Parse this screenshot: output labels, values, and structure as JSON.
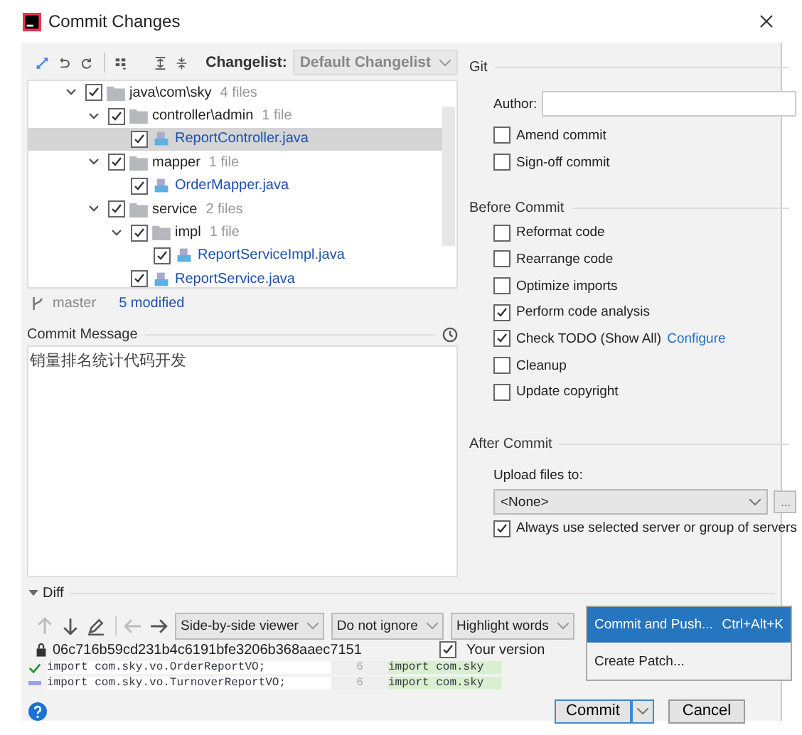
{
  "window": {
    "title": "Commit Changes"
  },
  "toolbar": {
    "changelist_label": "Changelist:",
    "changelist_value": "Default Changelist"
  },
  "tree": [
    {
      "name": "java\\com\\sky",
      "count": "4 files",
      "kind": "folder",
      "checked": true,
      "expanded": true,
      "selected": false,
      "children": [
        {
          "name": "controller\\admin",
          "count": "1 file",
          "kind": "folder",
          "checked": true,
          "expanded": true,
          "selected": false,
          "children": [
            {
              "name": "ReportController.java",
              "kind": "file",
              "checked": true,
              "selected": true
            }
          ]
        },
        {
          "name": "mapper",
          "count": "1 file",
          "kind": "folder",
          "checked": true,
          "expanded": true,
          "selected": false,
          "children": [
            {
              "name": "OrderMapper.java",
              "kind": "file",
              "checked": true,
              "selected": false
            }
          ]
        },
        {
          "name": "service",
          "count": "2 files",
          "kind": "folder",
          "checked": true,
          "expanded": true,
          "selected": false,
          "children": [
            {
              "name": "impl",
              "count": "1 file",
              "kind": "folder",
              "checked": true,
              "expanded": true,
              "selected": false,
              "children": [
                {
                  "name": "ReportServiceImpl.java",
                  "kind": "file",
                  "checked": true,
                  "selected": false
                }
              ]
            },
            {
              "name": "ReportService.java",
              "kind": "file",
              "checked": true,
              "selected": false
            }
          ]
        }
      ]
    }
  ],
  "status": {
    "branch": "master",
    "modified": "5 modified"
  },
  "commit_message": {
    "label": "Commit Message",
    "value": "销量排名统计代码开发"
  },
  "git": {
    "title": "Git",
    "author_label": "Author:",
    "options": [
      {
        "label": "Amend commit",
        "checked": false
      },
      {
        "label": "Sign-off commit",
        "checked": false
      }
    ]
  },
  "before_commit": {
    "title": "Before Commit",
    "options": [
      {
        "label": "Reformat code",
        "checked": false
      },
      {
        "label": "Rearrange code",
        "checked": false
      },
      {
        "label": "Optimize imports",
        "checked": false
      },
      {
        "label": "Perform code analysis",
        "checked": true
      },
      {
        "label": "Check TODO (Show All)",
        "checked": true,
        "link": "Configure"
      },
      {
        "label": "Cleanup",
        "checked": false
      },
      {
        "label": "Update copyright",
        "checked": false
      }
    ]
  },
  "after_commit": {
    "title": "After Commit",
    "upload_label": "Upload files to:",
    "upload_value": "<None>",
    "more": "...",
    "always": {
      "label": "Always use selected server or group of servers",
      "checked": true
    }
  },
  "diff": {
    "label": "Diff",
    "expanded": true,
    "viewer": "Side-by-side viewer",
    "ignore": "Do not ignore",
    "highlight": "Highlight words",
    "hash": "06c716b59cd231b4c6191bfe3206b368aaec7151",
    "your_version": {
      "label": "Your version",
      "checked": true
    },
    "lines": [
      {
        "number": "6",
        "left": "import com.sky.vo.OrderReportVO;",
        "right": "import com.sky"
      },
      {
        "number": "6",
        "left": "import com.sky.vo.TurnoverReportVO;",
        "right": "import com.sky"
      }
    ]
  },
  "menu": [
    {
      "label": "Commit and Push...",
      "shortcut": "Ctrl+Alt+K",
      "selected": true
    },
    {
      "label": "Create Patch...",
      "selected": false
    }
  ],
  "buttons": {
    "commit": "Commit",
    "cancel": "Cancel"
  }
}
